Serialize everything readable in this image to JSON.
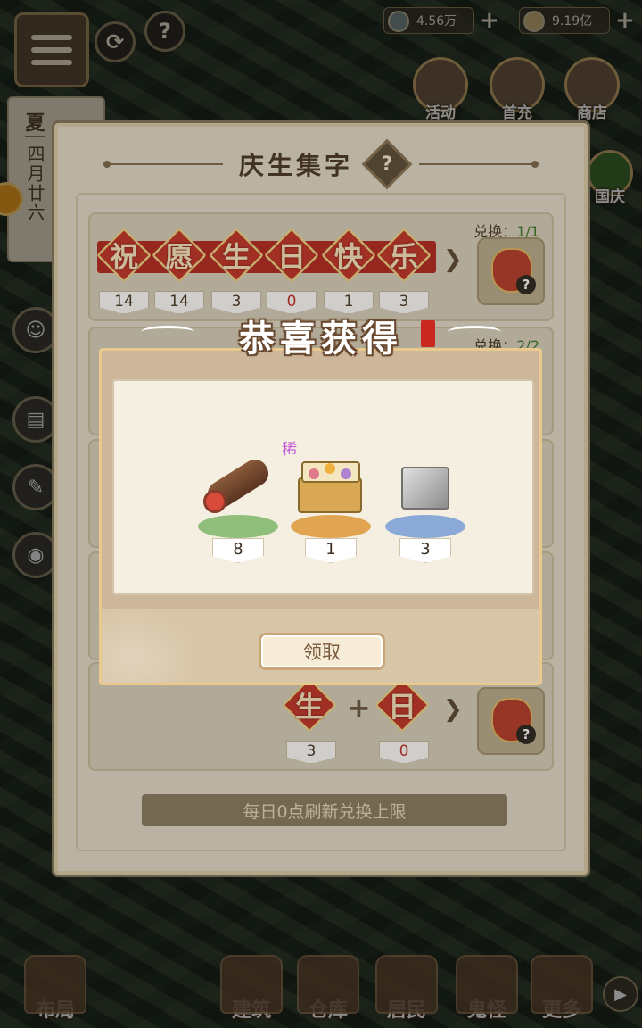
{
  "hud": {
    "resource1": "4.56万",
    "resource2": "9.19亿",
    "plus": "+",
    "help": "?"
  },
  "calendar": {
    "season": "夏",
    "date": "四月廿六"
  },
  "top_icons": [
    {
      "label": "活动"
    },
    {
      "label": "首充"
    },
    {
      "label": "商店"
    },
    {
      "label": "国庆"
    }
  ],
  "panel": {
    "title": "庆生集字",
    "help": "?",
    "rows": [
      {
        "exchange_label": "兑换：",
        "exchange_count": "1/1",
        "chars": [
          "祝",
          "愿",
          "生",
          "日",
          "快",
          "乐"
        ],
        "counts": [
          "14",
          "14",
          "3",
          "0",
          "1",
          "3"
        ]
      },
      {
        "exchange_label": "兑换：",
        "exchange_count": "2/2"
      },
      {
        "chars": [
          "生",
          "日"
        ],
        "counts": [
          "3",
          "0"
        ],
        "plus": "+"
      }
    ],
    "refresh_text": "每日0点刷新兑换上限"
  },
  "popup": {
    "title": "恭喜获得",
    "items": [
      {
        "name": "log-item",
        "count": "8",
        "plate_color": "#8fbf7a"
      },
      {
        "name": "treasure-box-item",
        "count": "1",
        "plate_color": "#e1a552",
        "rarity": "稀"
      },
      {
        "name": "stone-block-item",
        "count": "3",
        "plate_color": "#8aa9d6"
      }
    ],
    "claim_label": "领取"
  },
  "bottom_nav": [
    {
      "label": "布局"
    },
    {
      "label": "建筑"
    },
    {
      "label": "仓库"
    },
    {
      "label": "居民"
    },
    {
      "label": "鬼怪"
    },
    {
      "label": "更多"
    }
  ]
}
